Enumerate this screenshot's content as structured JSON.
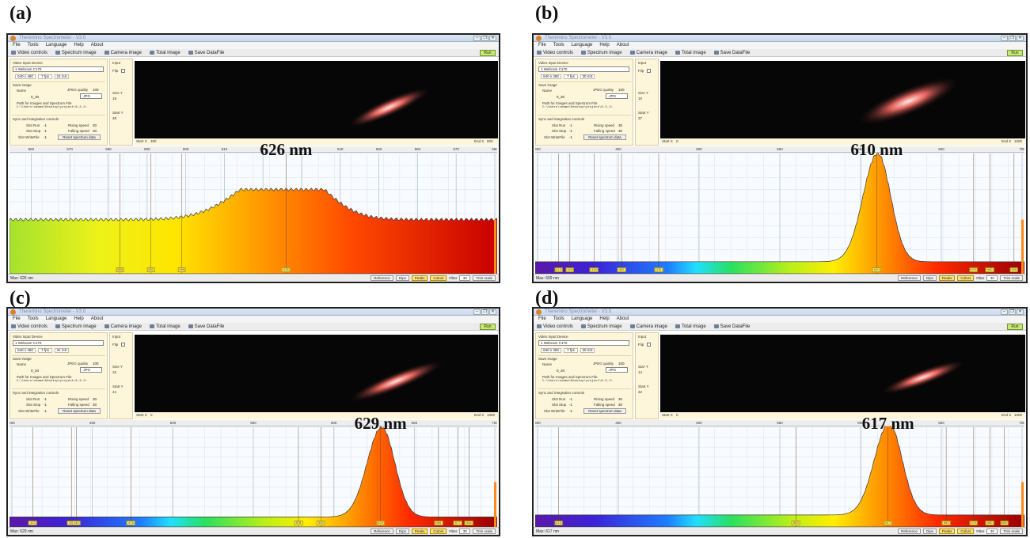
{
  "app": {
    "title": "Theremino Spectrometer - V3.0",
    "menus": [
      "File",
      "Tools",
      "Language",
      "Help",
      "About"
    ],
    "toolbar": [
      "Video controls",
      "Spectrum image",
      "Camera image",
      "Total image",
      "Save DataFile"
    ],
    "run": "Run",
    "window_buttons": [
      "–",
      "❐",
      "✕"
    ],
    "device_label": "Video Input Device",
    "device": "1 Webcam C170",
    "save_image_label": "Save image",
    "name_label": "Name",
    "jpeg_quality_label": "JPEG quality",
    "jpeg_quality": "100",
    "format": ".JPG",
    "path_label": "Path for Images and Spectrum File",
    "path": "C:\\Users\\veama\\Desktop\\project\\6.3.1\\",
    "sync_label": "Sync and integration controls",
    "slot_run_label": "Slot Run",
    "slot_stop_label": "Slot Stop",
    "slot_writefile_label": "Slot WriteFile",
    "slot_value": "-1",
    "rising_label": "Rising speed",
    "falling_label": "Falling speed",
    "reset_label": "Reset spectrum data",
    "input_label": "Input",
    "flip_label": "Flip",
    "size_y_label": "Size Y",
    "start_y_label": "Start Y",
    "start_x_label": "Start X",
    "end_x_label": "End X",
    "buttons": [
      "Reference",
      "Dips",
      "Peaks",
      "Colors"
    ],
    "filter_label": "Filter",
    "filter_value": "30",
    "trim_label": "Trim scale"
  },
  "panels": [
    {
      "letter": "(a)",
      "peak_text": "626 nm",
      "resolution": "640 x 480",
      "fps": "7 fps",
      "exposure": "24 mS",
      "name_value": "0_30",
      "rising": "30",
      "falling": "30",
      "size_y": "19",
      "start_y": "48",
      "start_x": "300",
      "end_x": "800",
      "status": "Max: 626 nm",
      "axis": {
        "min": 555,
        "max": 680,
        "ticks": [
          560,
          570,
          580,
          590,
          600,
          610,
          620,
          630,
          640,
          650,
          660,
          670,
          680
        ]
      },
      "chips": [
        {
          "nm": 583,
          "label": "583"
        },
        {
          "nm": 591,
          "label": "591"
        },
        {
          "nm": 599,
          "label": "599"
        },
        {
          "nm": 626,
          "label": "626"
        }
      ],
      "spectrum": "violet-start",
      "curve": {
        "type": "broad",
        "center": 626,
        "height": 0.62,
        "baseline": 0.45
      }
    },
    {
      "letter": "(b)",
      "peak_text": "610 nm",
      "resolution": "640 x 480",
      "fps": "7 fps",
      "exposure": "30 mS",
      "name_value": "0_30",
      "rising": "30",
      "falling": "30",
      "size_y": "10",
      "start_y": "37",
      "start_x": "0",
      "end_x": "1000",
      "status": "Max: 609 nm",
      "axis": {
        "min": 400,
        "max": 700,
        "ticks": [
          400,
          450,
          500,
          550,
          600,
          650,
          700
        ]
      },
      "chips": [
        {
          "nm": 413,
          "label": "413"
        },
        {
          "nm": 420,
          "label": "420"
        },
        {
          "nm": 435,
          "label": "435"
        },
        {
          "nm": 452,
          "label": "452"
        },
        {
          "nm": 475,
          "label": "475"
        },
        {
          "nm": 610,
          "label": "610"
        },
        {
          "nm": 670,
          "label": "670"
        },
        {
          "nm": 680,
          "label": "680"
        },
        {
          "nm": 695,
          "label": "695"
        }
      ],
      "spectrum": "full",
      "curve": {
        "type": "narrow",
        "center": 610,
        "height": 0.9,
        "baseline": 0.1
      }
    },
    {
      "letter": "(c)",
      "peak_text": "629 nm",
      "resolution": "640 x 480",
      "fps": "7 fps",
      "exposure": "31 mS",
      "name_value": "0_34",
      "rising": "30",
      "falling": "30",
      "size_y": "15",
      "start_y": "44",
      "start_x": "0",
      "end_x": "1000",
      "status": "Max: 629 nm",
      "axis": {
        "min": 400,
        "max": 700,
        "ticks": [
          400,
          450,
          500,
          550,
          600,
          650,
          700
        ]
      },
      "chips": [
        {
          "nm": 413,
          "label": "413"
        },
        {
          "nm": 437,
          "label": "437"
        },
        {
          "nm": 440,
          "label": "440"
        },
        {
          "nm": 474,
          "label": "474"
        },
        {
          "nm": 578,
          "label": "578"
        },
        {
          "nm": 592,
          "label": "592"
        },
        {
          "nm": 629,
          "label": "629"
        },
        {
          "nm": 665,
          "label": "665"
        },
        {
          "nm": 677,
          "label": "677"
        },
        {
          "nm": 684,
          "label": "684"
        }
      ],
      "spectrum": "full",
      "curve": {
        "type": "narrow",
        "center": 629,
        "height": 0.9,
        "baseline": 0.1
      }
    },
    {
      "letter": "(d)",
      "peak_text": "617 nm",
      "resolution": "640 x 480",
      "fps": "7 fps",
      "exposure": "30 mS",
      "name_value": "0_30",
      "rising": "30",
      "falling": "30",
      "size_y": "14",
      "start_y": "42",
      "start_x": "0",
      "end_x": "1000",
      "status": "Max: 617 nm",
      "axis": {
        "min": 400,
        "max": 700,
        "ticks": [
          400,
          450,
          500,
          550,
          600,
          650,
          700
        ]
      },
      "chips": [
        {
          "nm": 413,
          "label": "413"
        },
        {
          "nm": 560,
          "label": "560"
        },
        {
          "nm": 617,
          "label": "617"
        },
        {
          "nm": 653,
          "label": "653"
        },
        {
          "nm": 670,
          "label": "670"
        },
        {
          "nm": 680,
          "label": "680"
        },
        {
          "nm": 689,
          "label": "689"
        }
      ],
      "spectrum": "full",
      "curve": {
        "type": "narrow",
        "center": 617,
        "height": 0.92,
        "baseline": 0.12
      }
    }
  ]
}
